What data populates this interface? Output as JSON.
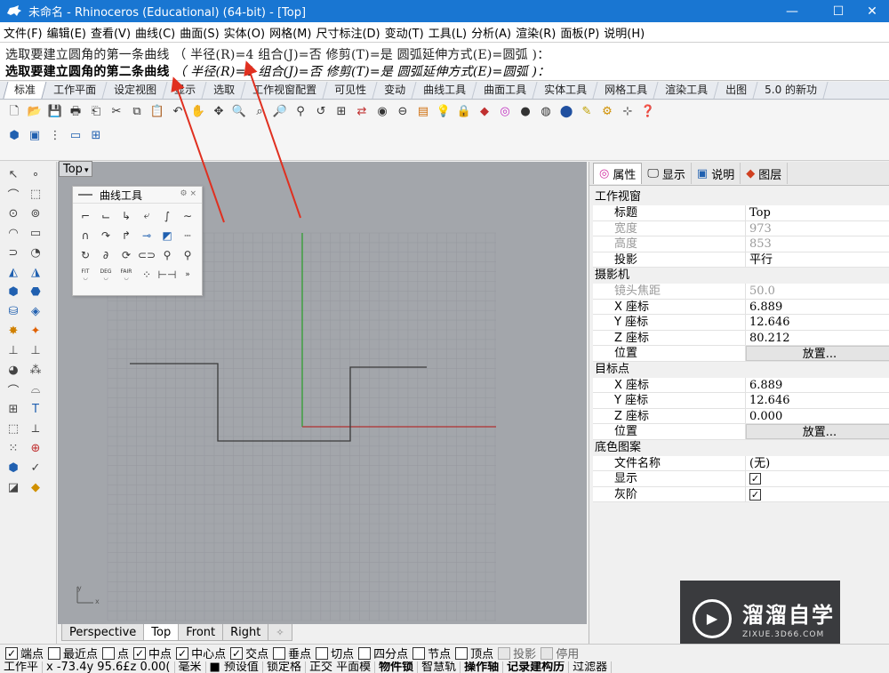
{
  "window": {
    "title": "未命名 - Rhinoceros (Educational) (64-bit) - [Top]",
    "minimize_glyph": "—",
    "maximize_glyph": "☐",
    "close_glyph": "✕",
    "icon": "rhino-icon"
  },
  "menu": [
    "文件(F)",
    "编辑(E)",
    "查看(V)",
    "曲线(C)",
    "曲面(S)",
    "实体(O)",
    "网格(M)",
    "尺寸标注(D)",
    "变动(T)",
    "工具(L)",
    "分析(A)",
    "渲染(R)",
    "面板(P)",
    "说明(H)"
  ],
  "command_history": {
    "line1": "选取要建立圆角的第一条曲线 （ 半径(R)=4 组合(J)=否 修剪(T)=是 圆弧延伸方式(E)=圆弧 )：",
    "line2_prompt": "选取要建立圆角的第二条曲线",
    "line2_options": " （ 半径(R)=4 组合(J)=否 修剪(T)=是 圆弧延伸方式(E)=圆弧 )："
  },
  "tabs": [
    "标准",
    "工作平面",
    "设定视图",
    "显示",
    "选取",
    "工作视窗配置",
    "可见性",
    "变动",
    "曲线工具",
    "曲面工具",
    "实体工具",
    "网格工具",
    "渲染工具",
    "出图",
    "5.0 的新功"
  ],
  "active_tab_index": 0,
  "toolbar1_icons": [
    "new-file",
    "open-file",
    "save",
    "print",
    "page-setup",
    "cut",
    "copy",
    "paste",
    "undo",
    "pan",
    "rotate-view",
    "zoom-window",
    "zoom-extents",
    "zoom-dynamic",
    "zoom-selected",
    "undo-view",
    "four-viewports",
    "grid-snap",
    "shade",
    "osnap",
    "layers",
    "light",
    "lock",
    "render",
    "color-wheel",
    "material-sphere",
    "render-preview",
    "environment",
    "pen",
    "settings",
    "osnap-tools",
    "help"
  ],
  "toolbar2_icons": [
    "box-3d",
    "viewport-icon",
    "vertical-split",
    "horizontal-split",
    "grid-layout"
  ],
  "left_tools": [
    "select-arrow",
    "point",
    "polyline",
    "rectangle-multi",
    "circle",
    "ellipse",
    "arc",
    "polygon",
    "fillet-curve",
    "surface-curve",
    "surface-patch",
    "solid-surface",
    "solid-box",
    "solid-boolean",
    "solid-cylinder",
    "mesh-surface",
    "transform",
    "light-source",
    "dimension",
    "annotation",
    "group",
    "analyze",
    "curve-curve",
    "curve-fillet",
    "array",
    "text-tool",
    "box-grid",
    "polyline-edit",
    "grid-points",
    "gumball",
    "layer-cube",
    "check-mark",
    "render-box",
    "material"
  ],
  "viewport": {
    "name": "Top",
    "caret": "▾",
    "axis_y": "y",
    "axis_x": "x",
    "tabs": [
      "Perspective",
      "Top",
      "Front",
      "Right"
    ],
    "active_tab": "Top",
    "add_tab": "✧"
  },
  "curve_panel": {
    "title": "曲线工具",
    "buttons": "⚙ ×",
    "icons": [
      "fillet",
      "chamfer",
      "blend",
      "offset",
      "rebuild",
      "extend",
      "arch",
      "trim",
      "fillet-corner",
      "adjust",
      "paint",
      "divide",
      "loop",
      "curve-analysis",
      "curve-project",
      "cut-curve",
      "connect-curve",
      "walking-curve",
      "fit-curve",
      "degree-curve",
      "fair-curve",
      "points",
      "control-points",
      "more"
    ],
    "fit_label": "FIT",
    "deg_label": "DEG",
    "fair_label": "FAIR",
    "more_label": "»"
  },
  "right_panel": {
    "tabs": [
      {
        "label": "属性",
        "icon": "color-wheel-icon"
      },
      {
        "label": "显示",
        "icon": "monitor-icon"
      },
      {
        "label": "说明",
        "icon": "help-icon"
      },
      {
        "label": "图层",
        "icon": "layers-icon"
      }
    ],
    "sections": [
      {
        "title": "工作视窗",
        "rows": [
          {
            "key": "标题",
            "value": "Top",
            "dim": false
          },
          {
            "key": "宽度",
            "value": "973",
            "dim": true
          },
          {
            "key": "高度",
            "value": "853",
            "dim": true
          },
          {
            "key": "投影",
            "value": "平行",
            "dim": false
          }
        ]
      },
      {
        "title": "摄影机",
        "rows": [
          {
            "key": "镜头焦距",
            "value": "50.0",
            "dim": true
          },
          {
            "key": "X 座标",
            "value": "6.889",
            "dim": false
          },
          {
            "key": "Y 座标",
            "value": "12.646",
            "dim": false
          },
          {
            "key": "Z 座标",
            "value": "80.212",
            "dim": false
          },
          {
            "key": "位置",
            "value": "放置...",
            "dim": false,
            "button": true
          }
        ]
      },
      {
        "title": "目标点",
        "rows": [
          {
            "key": "X 座标",
            "value": "6.889",
            "dim": false
          },
          {
            "key": "Y 座标",
            "value": "12.646",
            "dim": false
          },
          {
            "key": "Z 座标",
            "value": "0.000",
            "dim": false
          },
          {
            "key": "位置",
            "value": "放置...",
            "dim": false,
            "button": true
          }
        ]
      },
      {
        "title": "底色图案",
        "rows": [
          {
            "key": "文件名称",
            "value": "(无)",
            "dim": false
          },
          {
            "key": "显示",
            "value": "✓",
            "dim": false,
            "checkbox": true
          },
          {
            "key": "灰阶",
            "value": "✓",
            "dim": false,
            "checkbox": true
          }
        ]
      }
    ]
  },
  "logo": {
    "cn": "溜溜自学",
    "en": "ZIXUE.3D66.COM"
  },
  "osnap": [
    {
      "label": "端点",
      "checked": true
    },
    {
      "label": "最近点",
      "checked": false
    },
    {
      "label": "点",
      "checked": false
    },
    {
      "label": "中点",
      "checked": true
    },
    {
      "label": "中心点",
      "checked": true
    },
    {
      "label": "交点",
      "checked": true
    },
    {
      "label": "垂点",
      "checked": false
    },
    {
      "label": "切点",
      "checked": false
    },
    {
      "label": "四分点",
      "checked": false
    },
    {
      "label": "节点",
      "checked": false
    },
    {
      "label": "顶点",
      "checked": false
    },
    {
      "label": "投影",
      "checked": false,
      "disabled": true
    },
    {
      "label": "停用",
      "checked": false,
      "disabled": true
    }
  ],
  "statusbar": [
    {
      "text": "工作平",
      "bold": false
    },
    {
      "text": "x -73.4y 95.6£z 0.00(",
      "bold": false
    },
    {
      "text": "毫米",
      "bold": false
    },
    {
      "text": "■ 预设值",
      "bold": false
    },
    {
      "text": "锁定格",
      "bold": false
    },
    {
      "text": "正交 平面模",
      "bold": false
    },
    {
      "text": "物件锁",
      "bold": true
    },
    {
      "text": "智慧轨",
      "bold": false
    },
    {
      "text": "操作轴",
      "bold": true
    },
    {
      "text": "记录建构历",
      "bold": true
    },
    {
      "text": "过滤器",
      "bold": false
    }
  ],
  "colors": {
    "title_bar": "#1976d2",
    "viewport_bg": "#a3a6ab",
    "grid_line": "#979aa0",
    "x_axis": "#b03030",
    "y_axis": "#2aa02a",
    "curve": "#3a3a3a",
    "annotation_arrow": "#e03020"
  }
}
